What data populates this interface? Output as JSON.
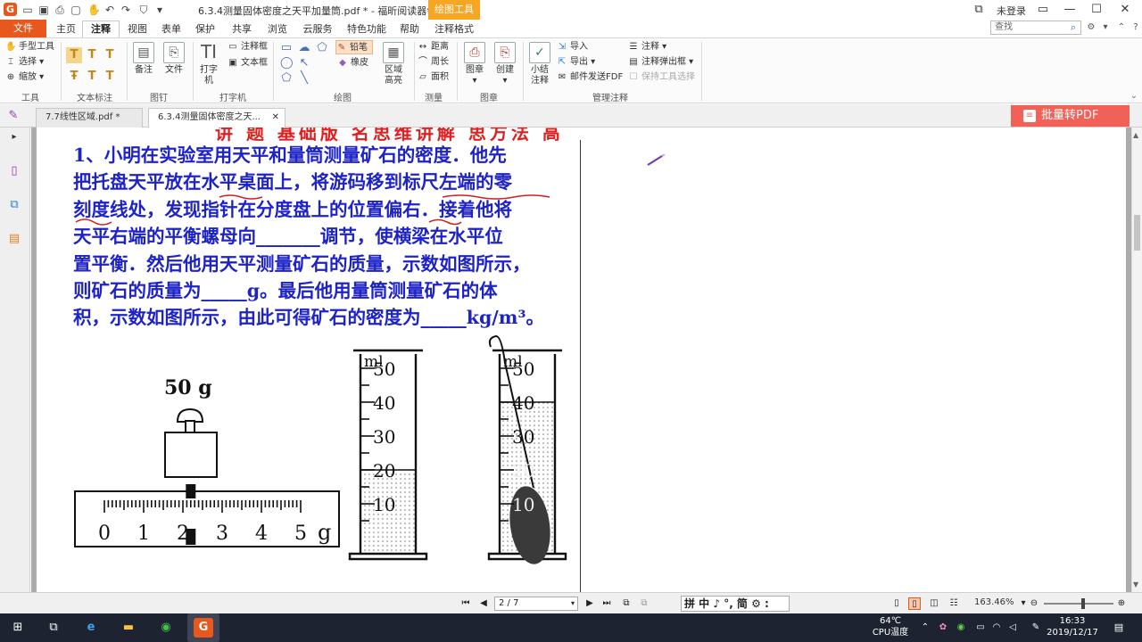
{
  "titlebar": {
    "doc_title": "6.3.4测量固体密度之天平加量筒.pdf * - 福昕阅读器领鲜版",
    "context_tab": "绘图工具",
    "login": "未登录"
  },
  "menu_tabs": [
    "文件",
    "主页",
    "注释",
    "视图",
    "表单",
    "保护",
    "共享",
    "浏览",
    "云服务",
    "特色功能",
    "帮助",
    "注释格式"
  ],
  "search": {
    "placeholder": "查找"
  },
  "ribbon": {
    "tools": {
      "hand": "手型工具",
      "select": "选择",
      "zoom": "缩放",
      "label": "工具"
    },
    "text_markup": {
      "label": "文本标注"
    },
    "pin": {
      "note": "备注",
      "file": "文件",
      "label": "图钉"
    },
    "typewriter": {
      "typewriter": "打字机",
      "callout": "注释框",
      "textbox": "文本框",
      "label": "打字机"
    },
    "drawing": {
      "pencil": "铅笔",
      "eraser": "橡皮",
      "area_highlight": "区域高亮",
      "label": "绘图"
    },
    "measure": {
      "distance": "距离",
      "perimeter": "周长",
      "area": "面积",
      "label": "测量"
    },
    "stamp": {
      "stamp": "图章",
      "create": "创建",
      "label": "图章"
    },
    "manage": {
      "summary": "小结注释",
      "import": "导入",
      "export": "导出",
      "email_fdf": "邮件发送FDF",
      "annotation": "注释",
      "popup": "注释弹出框",
      "keep_tool": "保持工具选择",
      "label": "管理注释"
    }
  },
  "doc_tabs": [
    {
      "title": "7.7线性区域.pdf *"
    },
    {
      "title": "6.3.4测量固体密度之天..."
    }
  ],
  "batch_button": "批量转PDF",
  "document": {
    "cut_red_text": "讲  题    基础版              名思维讲解              思方法        高",
    "question_lines": [
      "1、小明在实验室用天平和量筒测量矿石的密度．他先",
      "把托盘天平放在水平桌面上，将游码移到标尺左端的零",
      "刻度线处，发现指针在分度盘上的位置偏右．接着他将",
      "天平右端的平衡螺母向_______调节，使横梁在水平位",
      "置平衡．然后他用天平测量矿石的质量，示数如图所示，",
      "则矿石的质量为_____g。最后他用量筒测量矿石的体",
      "积，示数如图所示，由此可得矿石的密度为_____kg/m³。"
    ],
    "figure": {
      "weight_label": "50 g",
      "scale_ticks": [
        "0",
        "1",
        "2",
        "3",
        "4",
        "5"
      ],
      "scale_unit": "g",
      "rider_value": 2.2,
      "cylinder_unit": "ml",
      "cylinder_ticks": [
        "50",
        "40",
        "30",
        "20",
        "10"
      ],
      "cylinder1_level": 20,
      "cylinder2_level": 40
    }
  },
  "status": {
    "page": "2 / 7",
    "ime": "拼 中 ♪ °, 简 ⚙ :",
    "zoom": "163.46%"
  },
  "taskbar": {
    "cpu_temp": "64℃",
    "cpu_label": "CPU温度",
    "time": "16:33",
    "date": "2019/12/17"
  },
  "colors": {
    "brand": "#e8581d",
    "question_text": "#1e23c7",
    "batch_button": "#f16158",
    "taskbar": "#1d2330"
  }
}
